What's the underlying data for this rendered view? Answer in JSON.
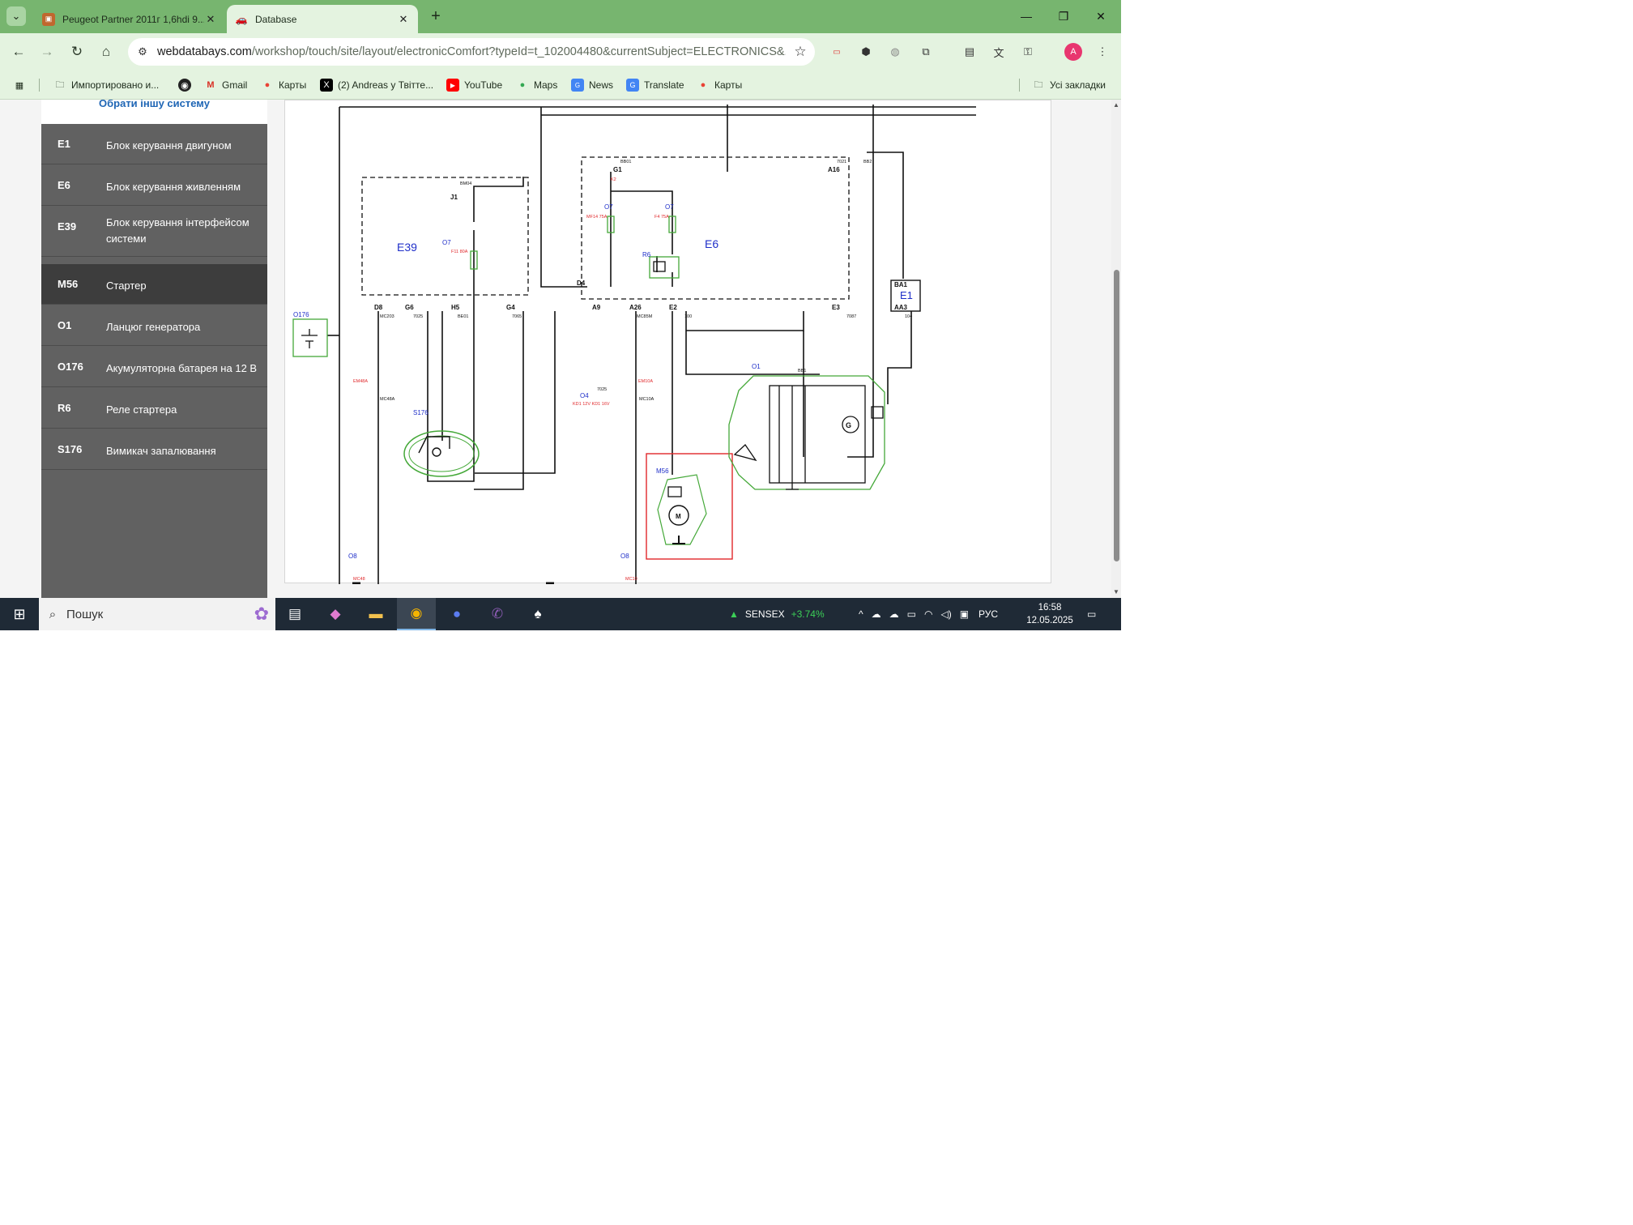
{
  "browser": {
    "tabs": [
      {
        "title": "Peugeot Partner 2011г 1,6hdi 9...",
        "icon": "car-photo-icon"
      },
      {
        "title": "Database",
        "icon": "car-icon"
      }
    ],
    "url_domain": "webdatabays.com",
    "url_path": "/workshop/touch/site/layout/electronicComfort?typeId=t_102004480&currentSubject=ELECTRONICS&...",
    "avatar_letter": "A",
    "bookmarks": [
      "Импортировано и...",
      "",
      "Gmail",
      "Карты",
      "(2) Andreas у Твітте...",
      "YouTube",
      "Maps",
      "News",
      "Translate",
      "Карты"
    ],
    "all_bookmarks": "Усі закладки"
  },
  "sidebar": {
    "other_system": "Обрати іншу систему",
    "items": [
      {
        "code": "E1",
        "label": "Блок керування двигуном"
      },
      {
        "code": "E6",
        "label": "Блок керування живленням"
      },
      {
        "code": "E39",
        "label": "Блок керування інтерфейсом системи"
      },
      {
        "code": "M56",
        "label": "Стартер"
      },
      {
        "code": "O1",
        "label": "Ланцюг генератора"
      },
      {
        "code": "O176",
        "label": "Акумуляторна батарея на 12 В"
      },
      {
        "code": "R6",
        "label": "Реле стартера"
      },
      {
        "code": "S176",
        "label": "Вимикач запалювання"
      }
    ],
    "selected_code": "M56"
  },
  "diagram": {
    "modules": {
      "e39": "E39",
      "e6": "E6",
      "e1": "E1",
      "ba1": "BA1",
      "aa3": "AA3"
    },
    "component_labels": {
      "o176": "O176",
      "s176": "S176",
      "m56": "M56",
      "o1": "O1",
      "r6": "R6",
      "o4": "O4",
      "o7a": "O7",
      "o7b": "O7",
      "o7c": "O7",
      "o8a": "O8",
      "o8b": "O8",
      "g": "G",
      "m": "M"
    },
    "pins": {
      "j1": "J1",
      "d8": "D8",
      "g6": "G6",
      "h5": "H5",
      "g4": "G4",
      "g1": "G1",
      "d4": "D4",
      "a16": "A16",
      "a9": "A9",
      "a26": "A26",
      "e2": "E2",
      "e3": "E3"
    },
    "wires": {
      "w1": "MC203",
      "w2": "7025",
      "w3": "BE01",
      "w4": "7065",
      "w5": "BM04",
      "w6": "BB01",
      "w7": "MC85M",
      "w8": "100",
      "w9": "7087",
      "w10": "104",
      "w11": "7021",
      "w12": "BB2",
      "w13": "MC48A",
      "w14": "MC10A",
      "w15": "7025",
      "w16": "BB1",
      "w17": "MC48",
      "w18": "MC10"
    },
    "red_notes": {
      "n1": "EM48A",
      "n2": "EM10A",
      "n3": "K2",
      "n4": "F11\n80A",
      "n5": "MF14\n75A",
      "n6": "F4\n75A",
      "n7": "KD1 12V\nKD1 16V"
    },
    "colors": {
      "blue": "#1f2fc9",
      "red": "#e0282b",
      "green": "#44a838",
      "starter_highlight": "#e0282b"
    }
  },
  "taskbar": {
    "search_placeholder": "Пошук",
    "ticker_name": "SENSEX",
    "ticker_change": "+3.74%",
    "lang": "РУС",
    "time": "16:58",
    "date": "12.05.2025"
  }
}
